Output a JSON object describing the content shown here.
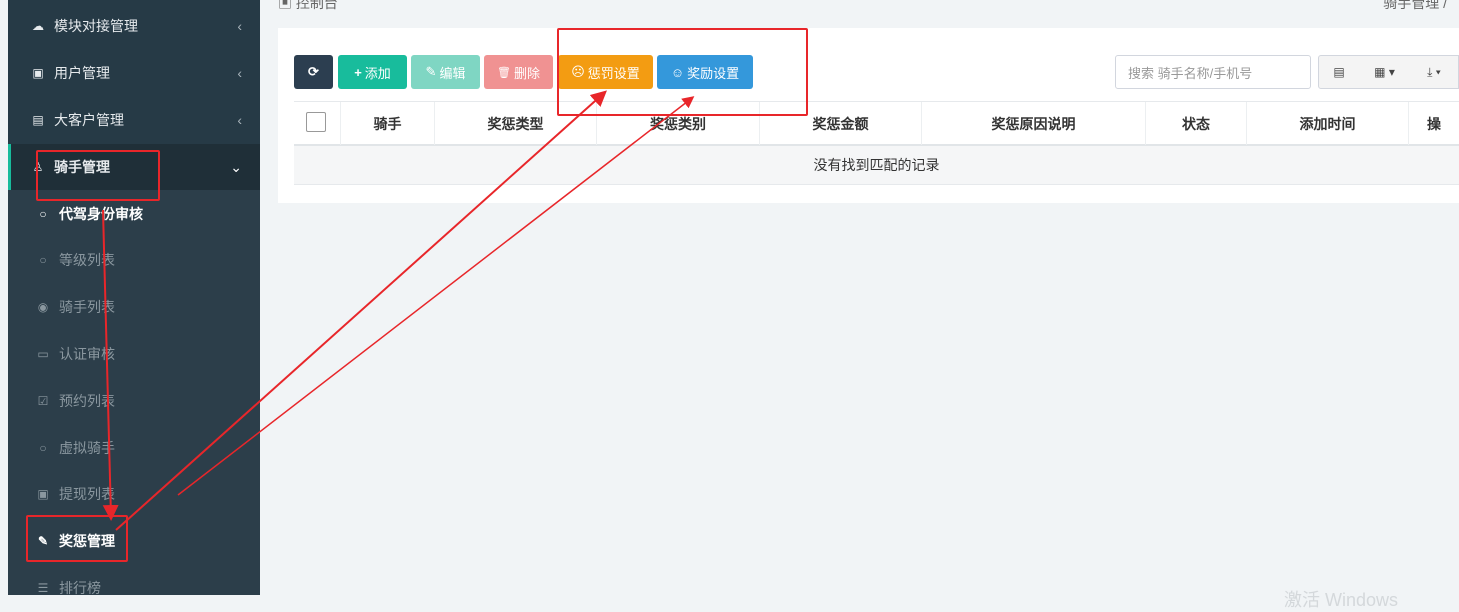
{
  "sidebar": {
    "items": [
      {
        "icon": "cloud-icon",
        "glyph": "☁",
        "label": "模块对接管理",
        "chevron": "‹"
      },
      {
        "icon": "user-card-icon",
        "glyph": "▣",
        "label": "用户管理",
        "chevron": "‹"
      },
      {
        "icon": "contact-book-icon",
        "glyph": "▤",
        "label": "大客户管理",
        "chevron": "‹"
      },
      {
        "icon": "rider-icon",
        "glyph": "♙",
        "label": "骑手管理",
        "chevron": "⌄"
      }
    ],
    "sub_items": [
      {
        "icon": "circle-icon",
        "glyph": "○",
        "label": "代驾身份审核"
      },
      {
        "icon": "circle-icon",
        "glyph": "○",
        "label": "等级列表"
      },
      {
        "icon": "user-circle-icon",
        "glyph": "◉",
        "label": "骑手列表"
      },
      {
        "icon": "id-card-icon",
        "glyph": "▭",
        "label": "认证审核"
      },
      {
        "icon": "check-square-icon",
        "glyph": "☑",
        "label": "预约列表"
      },
      {
        "icon": "circle-icon",
        "glyph": "○",
        "label": "虚拟骑手"
      },
      {
        "icon": "money-icon",
        "glyph": "▣",
        "label": "提现列表"
      },
      {
        "icon": "edit-icon",
        "glyph": "✎",
        "label": "奖惩管理"
      },
      {
        "icon": "list-icon",
        "glyph": "☰",
        "label": "排行榜"
      }
    ]
  },
  "breadcrumb": {
    "left": "控制台",
    "left_icon": "dashboard-icon",
    "right": "骑手管理 /"
  },
  "toolbar": {
    "refresh_glyph": "⟳",
    "add": "添加",
    "add_glyph": "+",
    "edit": "编辑",
    "edit_glyph": "✎",
    "delete": "删除",
    "delete_glyph": "🗑",
    "penalty": "惩罚设置",
    "penalty_glyph": "☹",
    "reward": "奖励设置",
    "reward_glyph": "☺",
    "search_placeholder": "搜索 骑手名称/手机号",
    "view_glyph": "▤",
    "columns_glyph": "▦ ▾",
    "export_glyph": "⤓ ▾"
  },
  "table": {
    "columns": [
      "骑手",
      "奖惩类型",
      "奖惩类别",
      "奖惩金额",
      "奖惩原因说明",
      "状态",
      "添加时间",
      "操"
    ],
    "empty": "没有找到匹配的记录"
  },
  "watermark": "激活 Windows",
  "colors": {
    "sidebar": "#263a46",
    "refresh": "#2c3e50",
    "add": "#18bc9c",
    "edit": "#7fd6c3",
    "delete": "#f09292",
    "penalty": "#f39c12",
    "reward": "#3498db",
    "annotation": "#e8262a"
  }
}
